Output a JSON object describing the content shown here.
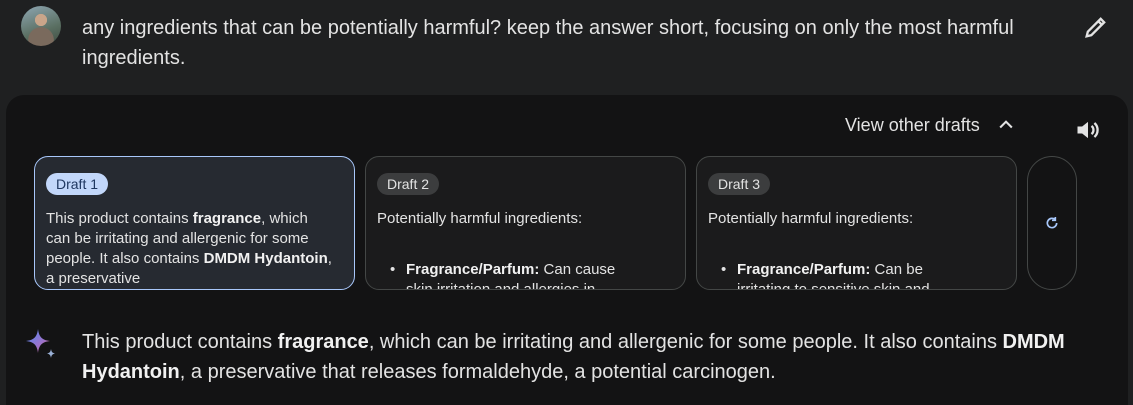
{
  "user": {
    "query": "any ingredients that can be potentially harmful? keep the answer short, focusing on only the most harmful ingredients."
  },
  "icons": {
    "edit": "pencil-icon",
    "drafts_toggle": "chevron-up-icon",
    "speaker": "speaker-icon",
    "regenerate": "refresh-icon",
    "assistant": "sparkle-icon"
  },
  "drafts_toggle": {
    "label": "View other drafts"
  },
  "drafts": [
    {
      "label": "Draft 1",
      "selected": true,
      "text_parts": [
        "This product contains ",
        "fragrance",
        ", which can be irritating and allergenic for some people. It also contains ",
        "DMDM Hydantoin",
        ", a preservative"
      ]
    },
    {
      "label": "Draft 2",
      "selected": false,
      "heading": "Potentially harmful ingredients:",
      "bullet_bold": "Fragrance/Parfum:",
      "bullet_text": " Can cause skin irritation and allergies in"
    },
    {
      "label": "Draft 3",
      "selected": false,
      "heading": "Potentially harmful ingredients:",
      "bullet_bold": "Fragrance/Parfum:",
      "bullet_text": " Can be irritating to sensitive skin and"
    }
  ],
  "answer": {
    "parts": [
      "This product contains ",
      "fragrance",
      ", which can be irritating and allergenic for some people. It also contains ",
      "DMDM Hydantoin",
      ", a preservative that releases formaldehyde, a potential carcinogen."
    ]
  },
  "colors": {
    "background": "#1f2021",
    "panel": "#131314",
    "accent": "#a8c7fa",
    "badge_selected": "#c2d7fa"
  }
}
